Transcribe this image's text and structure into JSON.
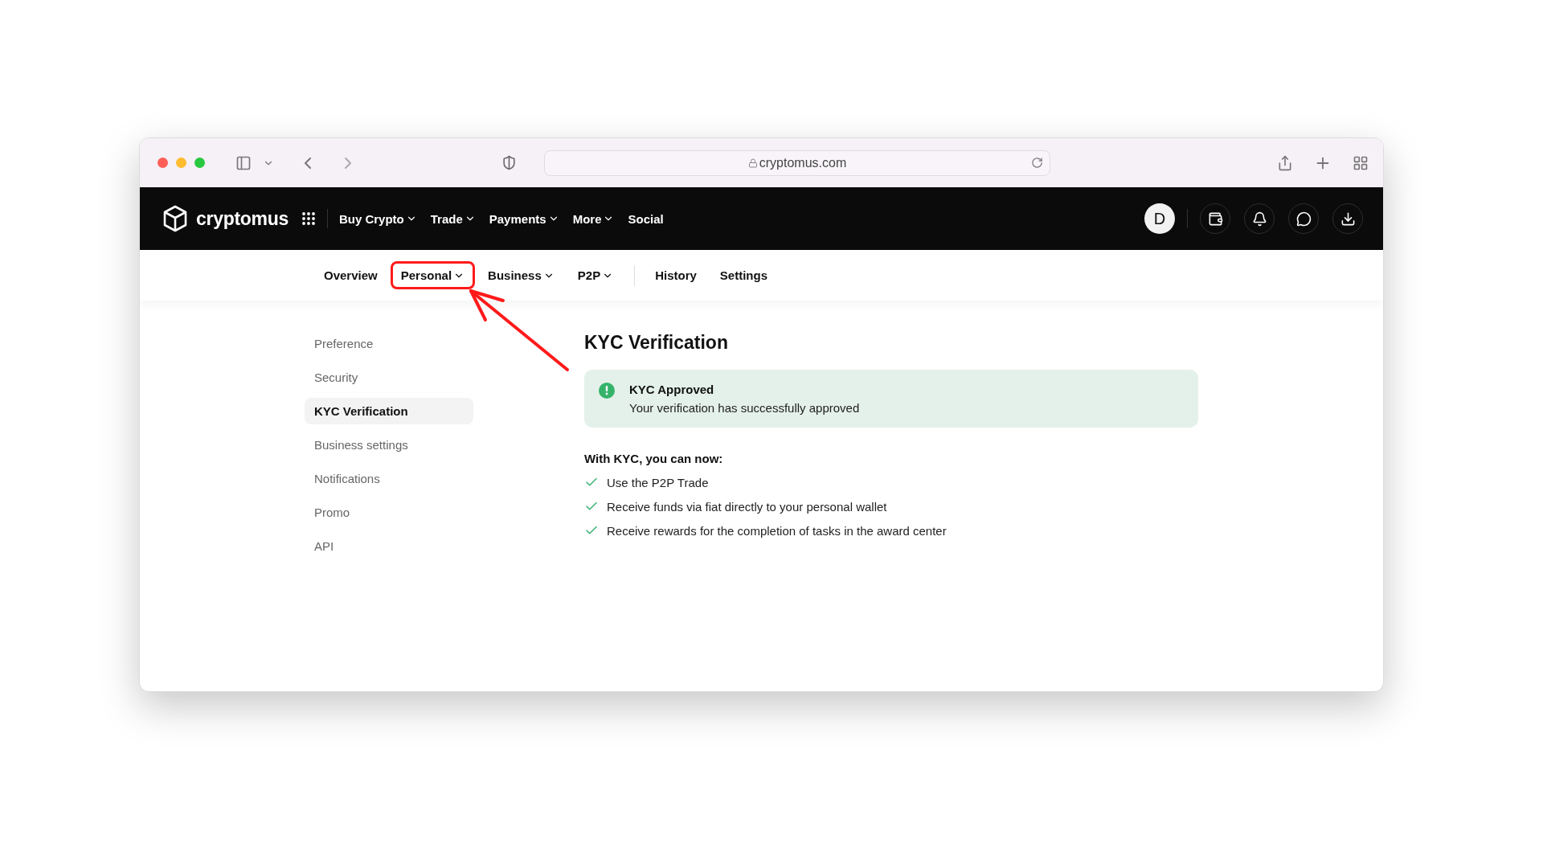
{
  "browser": {
    "url": "cryptomus.com"
  },
  "header": {
    "logo": "cryptomus",
    "nav": [
      {
        "label": "Buy Crypto",
        "dropdown": true
      },
      {
        "label": "Trade",
        "dropdown": true
      },
      {
        "label": "Payments",
        "dropdown": true
      },
      {
        "label": "More",
        "dropdown": true
      },
      {
        "label": "Social",
        "dropdown": false
      }
    ],
    "avatar": "D"
  },
  "subnav": {
    "groups": [
      [
        {
          "label": "Overview",
          "dropdown": false,
          "annotated": false
        },
        {
          "label": "Personal",
          "dropdown": true,
          "annotated": true
        },
        {
          "label": "Business",
          "dropdown": true,
          "annotated": false
        },
        {
          "label": "P2P",
          "dropdown": true,
          "annotated": false
        }
      ],
      [
        {
          "label": "History",
          "dropdown": false,
          "annotated": false
        },
        {
          "label": "Settings",
          "dropdown": false,
          "annotated": false
        }
      ]
    ]
  },
  "sidebar": {
    "items": [
      {
        "label": "Preference",
        "selected": false
      },
      {
        "label": "Security",
        "selected": false
      },
      {
        "label": "KYC Verification",
        "selected": true
      },
      {
        "label": "Business settings",
        "selected": false
      },
      {
        "label": "Notifications",
        "selected": false
      },
      {
        "label": "Promo",
        "selected": false
      },
      {
        "label": "API",
        "selected": false
      }
    ]
  },
  "content": {
    "title": "KYC Verification",
    "alert": {
      "title": "KYC Approved",
      "message": "Your verification has successfully approved"
    },
    "benefits_title": "With KYC, you can now:",
    "benefits": [
      "Use the P2P Trade",
      "Receive funds via fiat directly to your personal wallet",
      "Receive rewards for the completion of tasks in the award center"
    ]
  }
}
